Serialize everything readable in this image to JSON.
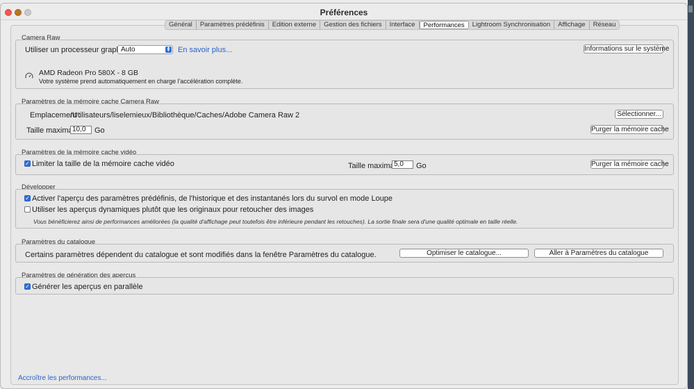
{
  "window": {
    "title": "Préférences"
  },
  "tabs": [
    "Général",
    "Paramètres prédéfinis",
    "Edition externe",
    "Gestion des fichiers",
    "Interface",
    "Performances",
    "Lightroom Synchronisation",
    "Affichage",
    "Réseau"
  ],
  "active_tab": "Performances",
  "camera_raw": {
    "section_title": "Camera Raw",
    "gpu_label": "Utiliser un processeur graphique :",
    "gpu_value": "Auto",
    "learn_more": "En savoir plus...",
    "system_info_button": "Informations sur le système",
    "gpu_name": "AMD Radeon Pro 580X - 8 GB",
    "gpu_desc": "Votre système prend automatiquement en charge l'accélération complète."
  },
  "raw_cache": {
    "section_title": "Paramètres de la mémoire cache Camera Raw",
    "location_label": "Emplacement :",
    "location_path": "/Utilisateurs/liselemieux/Bibliothèque/Caches/Adobe Camera Raw 2",
    "select_button": "Sélectionner...",
    "max_size_label": "Taille maximale :",
    "max_size_value": "10,0",
    "unit": "Go",
    "purge_button": "Purger la mémoire cache"
  },
  "video_cache": {
    "section_title": "Paramètres de la mémoire cache vidéo",
    "limit_label": "Limiter la taille de la mémoire cache vidéo",
    "limit_checked": true,
    "max_size_label": "Taille maximale :",
    "max_size_value": "5,0",
    "unit": "Go",
    "purge_button": "Purger la mémoire cache"
  },
  "develop": {
    "section_title": "Développer",
    "option1": "Activer l'aperçu des paramètres prédéfinis, de l'historique et des instantanés lors du survol en mode Loupe",
    "option1_checked": true,
    "option2": "Utiliser les aperçus dynamiques plutôt que les originaux pour retoucher des images",
    "option2_checked": false,
    "note": "Vous bénéficierez ainsi de performances améliorées (la qualité d'affichage peut toutefois être inférieure pendant les retouches). La sortie finale sera d'une qualité optimale en taille réelle."
  },
  "catalog": {
    "section_title": "Paramètres du catalogue",
    "desc": "Certains paramètres dépendent du catalogue et sont modifiés dans la fenêtre Paramètres du catalogue.",
    "optimize_button": "Optimiser le catalogue...",
    "goto_button": "Aller à Paramètres du catalogue"
  },
  "previews": {
    "section_title": "Paramètres de génération des aperçus",
    "parallel_label": "Générer les aperçus en parallèle",
    "parallel_checked": true
  },
  "footer_link": "Accroître les performances...",
  "colors": {
    "accent": "#2f6fdc",
    "link": "#2a62c9"
  }
}
